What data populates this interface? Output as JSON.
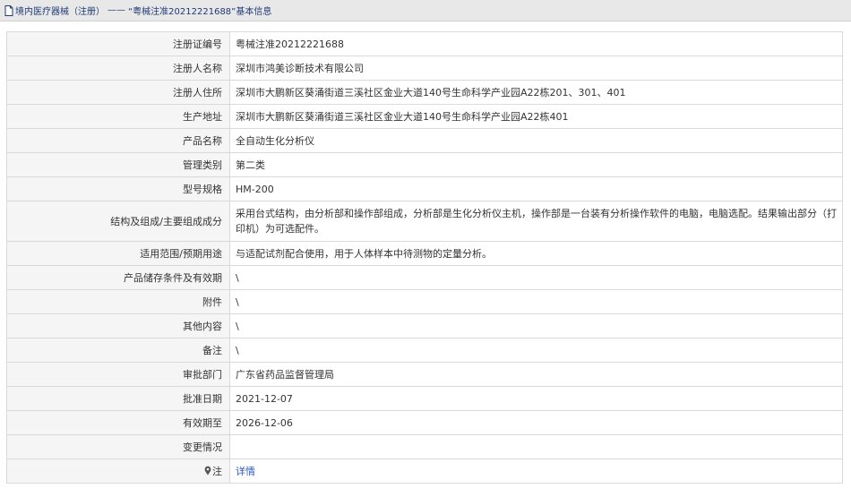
{
  "breadcrumb": {
    "category": "境内医疗器械（注册）",
    "separator": "——",
    "record": "“粤械注准20212221688”",
    "section": "基本信息"
  },
  "rows": [
    {
      "label": "注册证编号",
      "value": "粤械注准20212221688"
    },
    {
      "label": "注册人名称",
      "value": "深圳市鸿美诊断技术有限公司"
    },
    {
      "label": "注册人住所",
      "value": "深圳市大鹏新区葵涌街道三溪社区金业大道140号生命科学产业园A22栋201、301、401"
    },
    {
      "label": "生产地址",
      "value": "深圳市大鹏新区葵涌街道三溪社区金业大道140号生命科学产业园A22栋401"
    },
    {
      "label": "产品名称",
      "value": "全自动生化分析仪"
    },
    {
      "label": "管理类别",
      "value": "第二类"
    },
    {
      "label": "型号规格",
      "value": "HM-200"
    },
    {
      "label": "结构及组成/主要组成成分",
      "value": "采用台式结构，由分析部和操作部组成，分析部是生化分析仪主机，操作部是一台装有分析操作软件的电脑，电脑选配。结果输出部分（打印机）为可选配件。"
    },
    {
      "label": "适用范围/预期用途",
      "value": "与适配试剂配合使用，用于人体样本中待测物的定量分析。"
    },
    {
      "label": "产品储存条件及有效期",
      "value": "\\"
    },
    {
      "label": "附件",
      "value": "\\"
    },
    {
      "label": "其他内容",
      "value": "\\"
    },
    {
      "label": "备注",
      "value": "\\"
    },
    {
      "label": "审批部门",
      "value": "广东省药品监督管理局"
    },
    {
      "label": "批准日期",
      "value": "2021-12-07"
    },
    {
      "label": "有效期至",
      "value": "2026-12-06"
    },
    {
      "label": "变更情况",
      "value": ""
    }
  ],
  "note": {
    "label": "注",
    "link": "详情"
  },
  "colors": {
    "link": "#2a59c6",
    "breadcrumb": "#1f3a75",
    "label_bg": "#f5f5f5",
    "border": "#d9d9d9"
  }
}
